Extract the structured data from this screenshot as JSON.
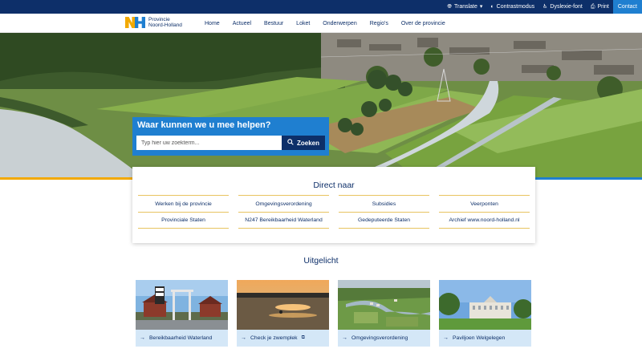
{
  "utility": {
    "translate": "Translate",
    "contrast": "Contrastmodus",
    "dyslexia": "Dyslexie-font",
    "print": "Print",
    "contact": "Contact"
  },
  "logo": {
    "line1": "Provincie",
    "line2": "Noord-Holland"
  },
  "nav": {
    "items": [
      {
        "label": "Home"
      },
      {
        "label": "Actueel"
      },
      {
        "label": "Bestuur"
      },
      {
        "label": "Loket"
      },
      {
        "label": "Onderwerpen"
      },
      {
        "label": "Regio's"
      },
      {
        "label": "Over de provincie"
      }
    ]
  },
  "search": {
    "title": "Waar kunnen we u mee helpen?",
    "placeholder": "Typ hier uw zoekterm...",
    "button": "Zoeken"
  },
  "direct": {
    "title": "Direct naar",
    "links": [
      {
        "label": "Werken bij de provincie"
      },
      {
        "label": "Omgevingsverordening"
      },
      {
        "label": "Subsidies"
      },
      {
        "label": "Veerponten"
      },
      {
        "label": "Provinciale Staten"
      },
      {
        "label": "N247 Bereikbaarheid Waterland"
      },
      {
        "label": "Gedeputeerde Staten"
      },
      {
        "label": "Archief www.noord-holland.nl"
      }
    ]
  },
  "uitgelicht": {
    "title": "Uitgelicht",
    "cards": [
      {
        "label": "Bereikbaarheid Waterland"
      },
      {
        "label": "Check je zwemplek"
      },
      {
        "label": "Omgevingsverordening"
      },
      {
        "label": "Paviljoen Welgelegen"
      }
    ]
  },
  "colors": {
    "navy": "#0d2f69",
    "blue": "#1f7fd0",
    "yellow": "#f2a900",
    "card_bg": "#d4e7f7"
  }
}
